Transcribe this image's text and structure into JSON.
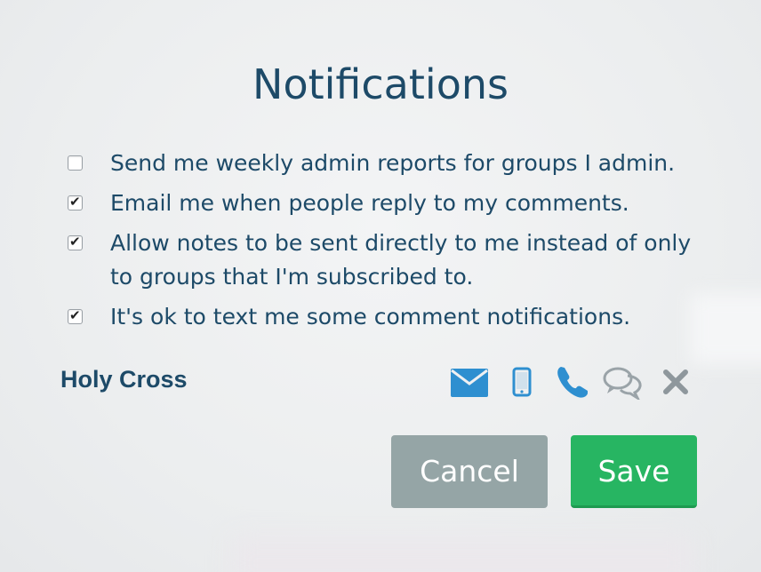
{
  "dialog": {
    "title": "Notifications",
    "options": [
      {
        "label": "Send me weekly admin reports for groups I admin.",
        "checked": false
      },
      {
        "label": "Email me when people reply to my comments.",
        "checked": true
      },
      {
        "label": "Allow notes to be sent directly to me instead of only to groups that I'm subscribed to.",
        "checked": true
      },
      {
        "label": "It's ok to text me some comment notifications.",
        "checked": true
      }
    ],
    "group": {
      "name": "Holy Cross",
      "channels": [
        {
          "icon": "envelope-icon",
          "color": "#2e8fd0"
        },
        {
          "icon": "mobile-phone-icon",
          "color": "#2e8fd0"
        },
        {
          "icon": "phone-icon",
          "color": "#2e8fd0"
        },
        {
          "icon": "chat-bubbles-icon",
          "color": "#9aa3a8"
        },
        {
          "icon": "close-icon",
          "color": "#8e979c"
        }
      ]
    },
    "buttons": {
      "cancel_label": "Cancel",
      "save_label": "Save"
    }
  }
}
